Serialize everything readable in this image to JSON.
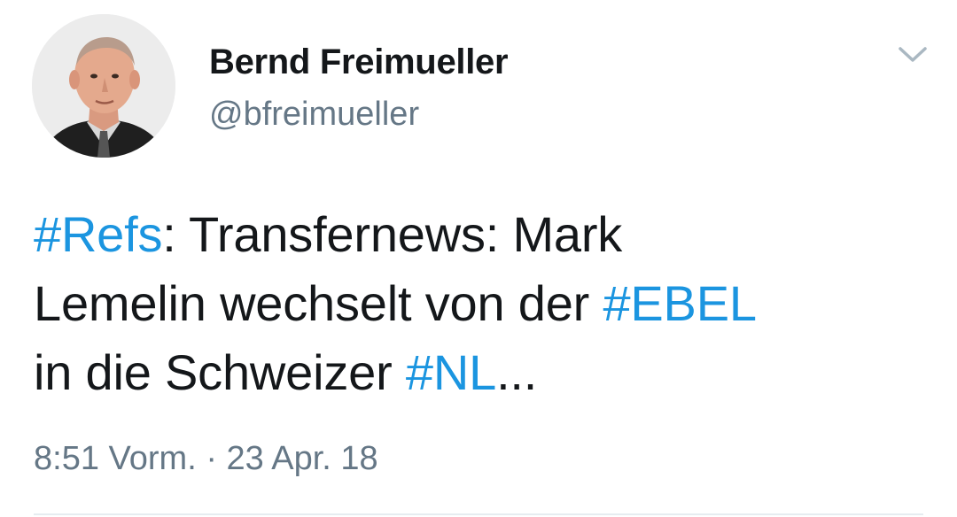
{
  "user": {
    "display_name": "Bernd Freimueller",
    "handle": "@bfreimueller"
  },
  "tweet": {
    "line1": {
      "hashtag": "#Refs",
      "text": ": Transfernews: Mark"
    },
    "line2": {
      "text": "Lemelin wechselt von der ",
      "hashtag": "#EBEL"
    },
    "line3": {
      "text": "in die Schweizer ",
      "hashtag": "#NL",
      "suffix": "..."
    }
  },
  "meta": {
    "timestamp": "8:51 Vorm. · 23 Apr. 18"
  },
  "colors": {
    "hashtag": "#1b95e0",
    "secondary_text": "#657786",
    "primary_text": "#14171a",
    "divider": "#e6ecf0"
  },
  "icons": {
    "menu": "chevron-down-icon",
    "avatar": "profile-photo"
  }
}
